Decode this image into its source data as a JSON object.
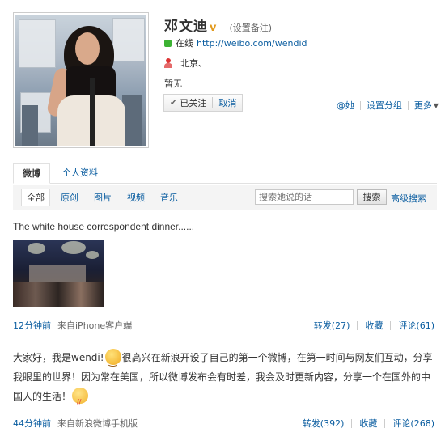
{
  "profile": {
    "name": "邓文迪",
    "verified_mark": "v",
    "remark_label": "(设置备注)",
    "status": "在线",
    "url": "http://weibo.com/wendid",
    "location": "北京、",
    "bio": "暂无",
    "followed_label": "已关注",
    "unfollow_label": "取消",
    "at_label": "@她",
    "group_label": "设置分组",
    "more_label": "更多"
  },
  "tabs": [
    {
      "label": "微博"
    },
    {
      "label": "个人资料"
    }
  ],
  "filter": {
    "chips": [
      "全部",
      "原创",
      "图片",
      "视频",
      "音乐"
    ],
    "search_placeholder": "搜索她说的话",
    "search_button": "搜索",
    "advanced_search": "高级搜索"
  },
  "posts": [
    {
      "text": "The white house correspondent dinner......",
      "time": "12分钟前",
      "source": "来自iPhone客户端",
      "repost": "转发(27)",
      "favorite": "收藏",
      "comment": "评论(61)"
    },
    {
      "text_a": "大家好，我是wendi!",
      "text_b": "很高兴在新浪开设了自己的第一个微博，在第一时间与网友们互动，分享我眼里的世界！因为常在美国，所以微博发布会有时差，我会及时更新内容，分享一个在国外的中国人的生活！",
      "time": "44分钟前",
      "source": "来自新浪微博手机版",
      "repost": "转发(392)",
      "favorite": "收藏",
      "comment": "评论(268)"
    }
  ],
  "colors": {
    "link": "#0a5da0",
    "online": "#3cb233",
    "verified": "#e29a1e"
  }
}
